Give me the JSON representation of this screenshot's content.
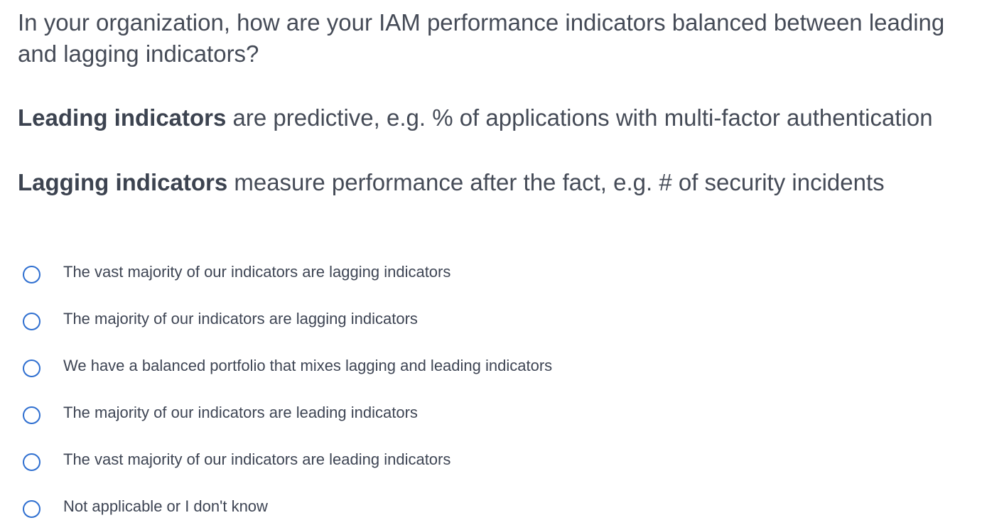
{
  "question": "In your organization, how are your IAM performance indicators balanced between leading and lagging indicators?",
  "definitions": {
    "leading": {
      "term": "Leading indicators",
      "text": " are predictive, e.g. % of applications with multi-factor authentication"
    },
    "lagging": {
      "term": "Lagging indicators",
      "text": " measure performance after the fact, e.g. # of security incidents"
    }
  },
  "options": [
    {
      "label": "The vast majority of our indicators are lagging indicators",
      "selected": false
    },
    {
      "label": "The majority of our indicators are lagging indicators",
      "selected": false
    },
    {
      "label": "We have a balanced portfolio that mixes lagging and leading indicators",
      "selected": false
    },
    {
      "label": "The majority of our indicators are leading indicators",
      "selected": false
    },
    {
      "label": "The vast majority of our indicators are leading indicators",
      "selected": false
    },
    {
      "label": "Not applicable or I don't know",
      "selected": false
    }
  ],
  "colors": {
    "radio_border": "#2f6fd0",
    "text": "#454b57"
  }
}
